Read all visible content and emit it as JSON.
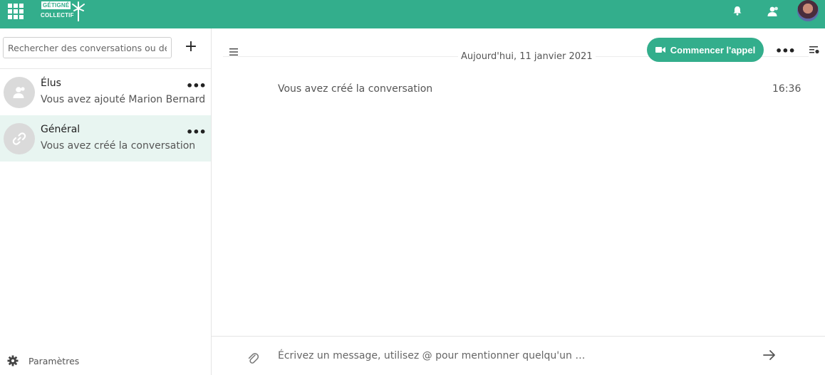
{
  "header": {
    "logo_top": "GÉTIGNÉ",
    "logo_bottom": "COLLECTIF",
    "icons": [
      "apps-icon",
      "bell-icon",
      "contacts-icon",
      "avatar"
    ],
    "accent_color": "#33ae8c"
  },
  "sidebar": {
    "search_placeholder": "Rechercher des conversations ou des u",
    "add_label": "+",
    "conversations": [
      {
        "name": "Élus",
        "last_message": "Vous avez ajouté Marion Bernard",
        "icon": "group-icon",
        "more": "•••",
        "active": false
      },
      {
        "name": "Général",
        "last_message": "Vous avez créé la conversation",
        "icon": "link-icon",
        "more": "•••",
        "active": true
      }
    ],
    "settings_label": "Paramètres"
  },
  "main": {
    "date_separator": "Aujourd'hui, 11 janvier 2021",
    "call_button": "Commencer l'appel",
    "more": "•••",
    "messages": [
      {
        "text": "Vous avez créé la conversation",
        "time": "16:36"
      }
    ],
    "composer_placeholder": "Écrivez un message, utilisez @ pour mentionner quelqu'un …"
  }
}
